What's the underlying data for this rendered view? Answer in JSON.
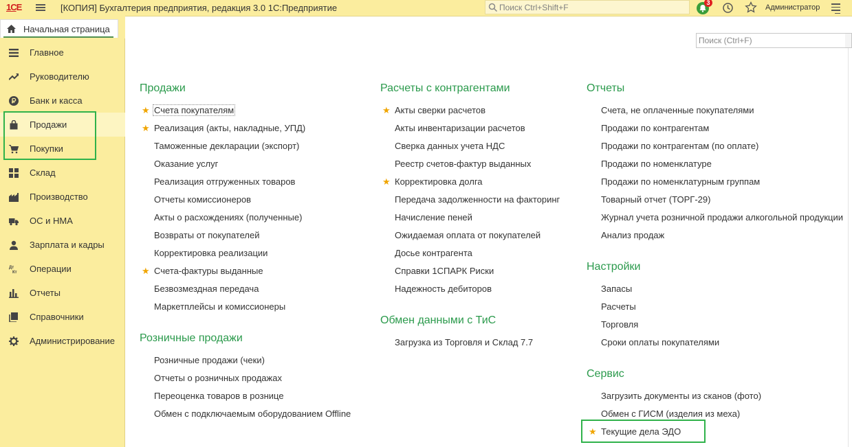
{
  "titlebar": {
    "logo": "1С",
    "title": "[КОПИЯ] Бухгалтерия предприятия, редакция 3.0 1С:Предприятие",
    "search_placeholder": "Поиск Ctrl+Shift+F",
    "notification_count": "3",
    "user": "Администратор"
  },
  "home_tab": {
    "label": "Начальная страница"
  },
  "sidebar": {
    "items": [
      {
        "label": "Главное",
        "icon": "menu-icon"
      },
      {
        "label": "Руководителю",
        "icon": "trend-icon"
      },
      {
        "label": "Банк и касса",
        "icon": "ruble-icon"
      },
      {
        "label": "Продажи",
        "icon": "bag-icon"
      },
      {
        "label": "Покупки",
        "icon": "cart-icon"
      },
      {
        "label": "Склад",
        "icon": "warehouse-icon"
      },
      {
        "label": "Производство",
        "icon": "factory-icon"
      },
      {
        "label": "ОС и НМА",
        "icon": "truck-icon"
      },
      {
        "label": "Зарплата и кадры",
        "icon": "person-icon"
      },
      {
        "label": "Операции",
        "icon": "dt-kt-icon"
      },
      {
        "label": "Отчеты",
        "icon": "bar-chart-icon"
      },
      {
        "label": "Справочники",
        "icon": "books-icon"
      },
      {
        "label": "Администрирование",
        "icon": "gear-icon"
      }
    ]
  },
  "panel_search": {
    "placeholder": "Поиск (Ctrl+F)"
  },
  "sections": {
    "prodazhi": {
      "title": "Продажи",
      "items": [
        "Счета покупателям",
        "Реализация (акты, накладные, УПД)",
        "Таможенные декларации (экспорт)",
        "Оказание услуг",
        "Реализация отгруженных товаров",
        "Отчеты комиссионеров",
        "Акты о расхождениях (полученные)",
        "Возвраты от покупателей",
        "Корректировка реализации",
        "Счета-фактуры выданные",
        "Безвозмездная передача",
        "Маркетплейсы и комиссионеры"
      ]
    },
    "roznica": {
      "title": "Розничные продажи",
      "items": [
        "Розничные продажи (чеки)",
        "Отчеты о розничных продажах",
        "Переоценка товаров в рознице",
        "Обмен с подключаемым оборудованием Offline"
      ]
    },
    "raschety": {
      "title": "Расчеты с контрагентами",
      "items": [
        "Акты сверки расчетов",
        "Акты инвентаризации расчетов",
        "Сверка данных учета НДС",
        "Реестр счетов-фактур выданных",
        "Корректировка долга",
        "Передача задолженности на факторинг",
        "Начисление пеней",
        "Ожидаемая оплата от покупателей",
        "Досье контрагента",
        "Справки 1СПАРК Риски",
        "Надежность дебиторов"
      ]
    },
    "obmen": {
      "title": "Обмен данными с ТиС",
      "items": [
        "Загрузка из Торговля и Склад 7.7"
      ]
    },
    "otchety": {
      "title": "Отчеты",
      "items": [
        "Счета, не оплаченные покупателями",
        "Продажи по контрагентам",
        "Продажи по контрагентам (по оплате)",
        "Продажи по номенклатуре",
        "Продажи по номенклатурным группам",
        "Товарный отчет (ТОРГ-29)",
        "Журнал учета розничной продажи алкогольной продукции",
        "Анализ продаж"
      ]
    },
    "nastroiki": {
      "title": "Настройки",
      "items": [
        "Запасы",
        "Расчеты",
        "Торговля",
        "Сроки оплаты покупателями"
      ]
    },
    "servis": {
      "title": "Сервис",
      "items": [
        "Загрузить документы из сканов (фото)",
        "Обмен с ГИСМ (изделия из меха)",
        "Текущие дела ЭДО"
      ]
    }
  },
  "colors": {
    "accent_green": "#2b9a4c",
    "sidebar_bg": "#fbed9e",
    "star": "#f0a500",
    "highlight": "#2fb24a"
  }
}
